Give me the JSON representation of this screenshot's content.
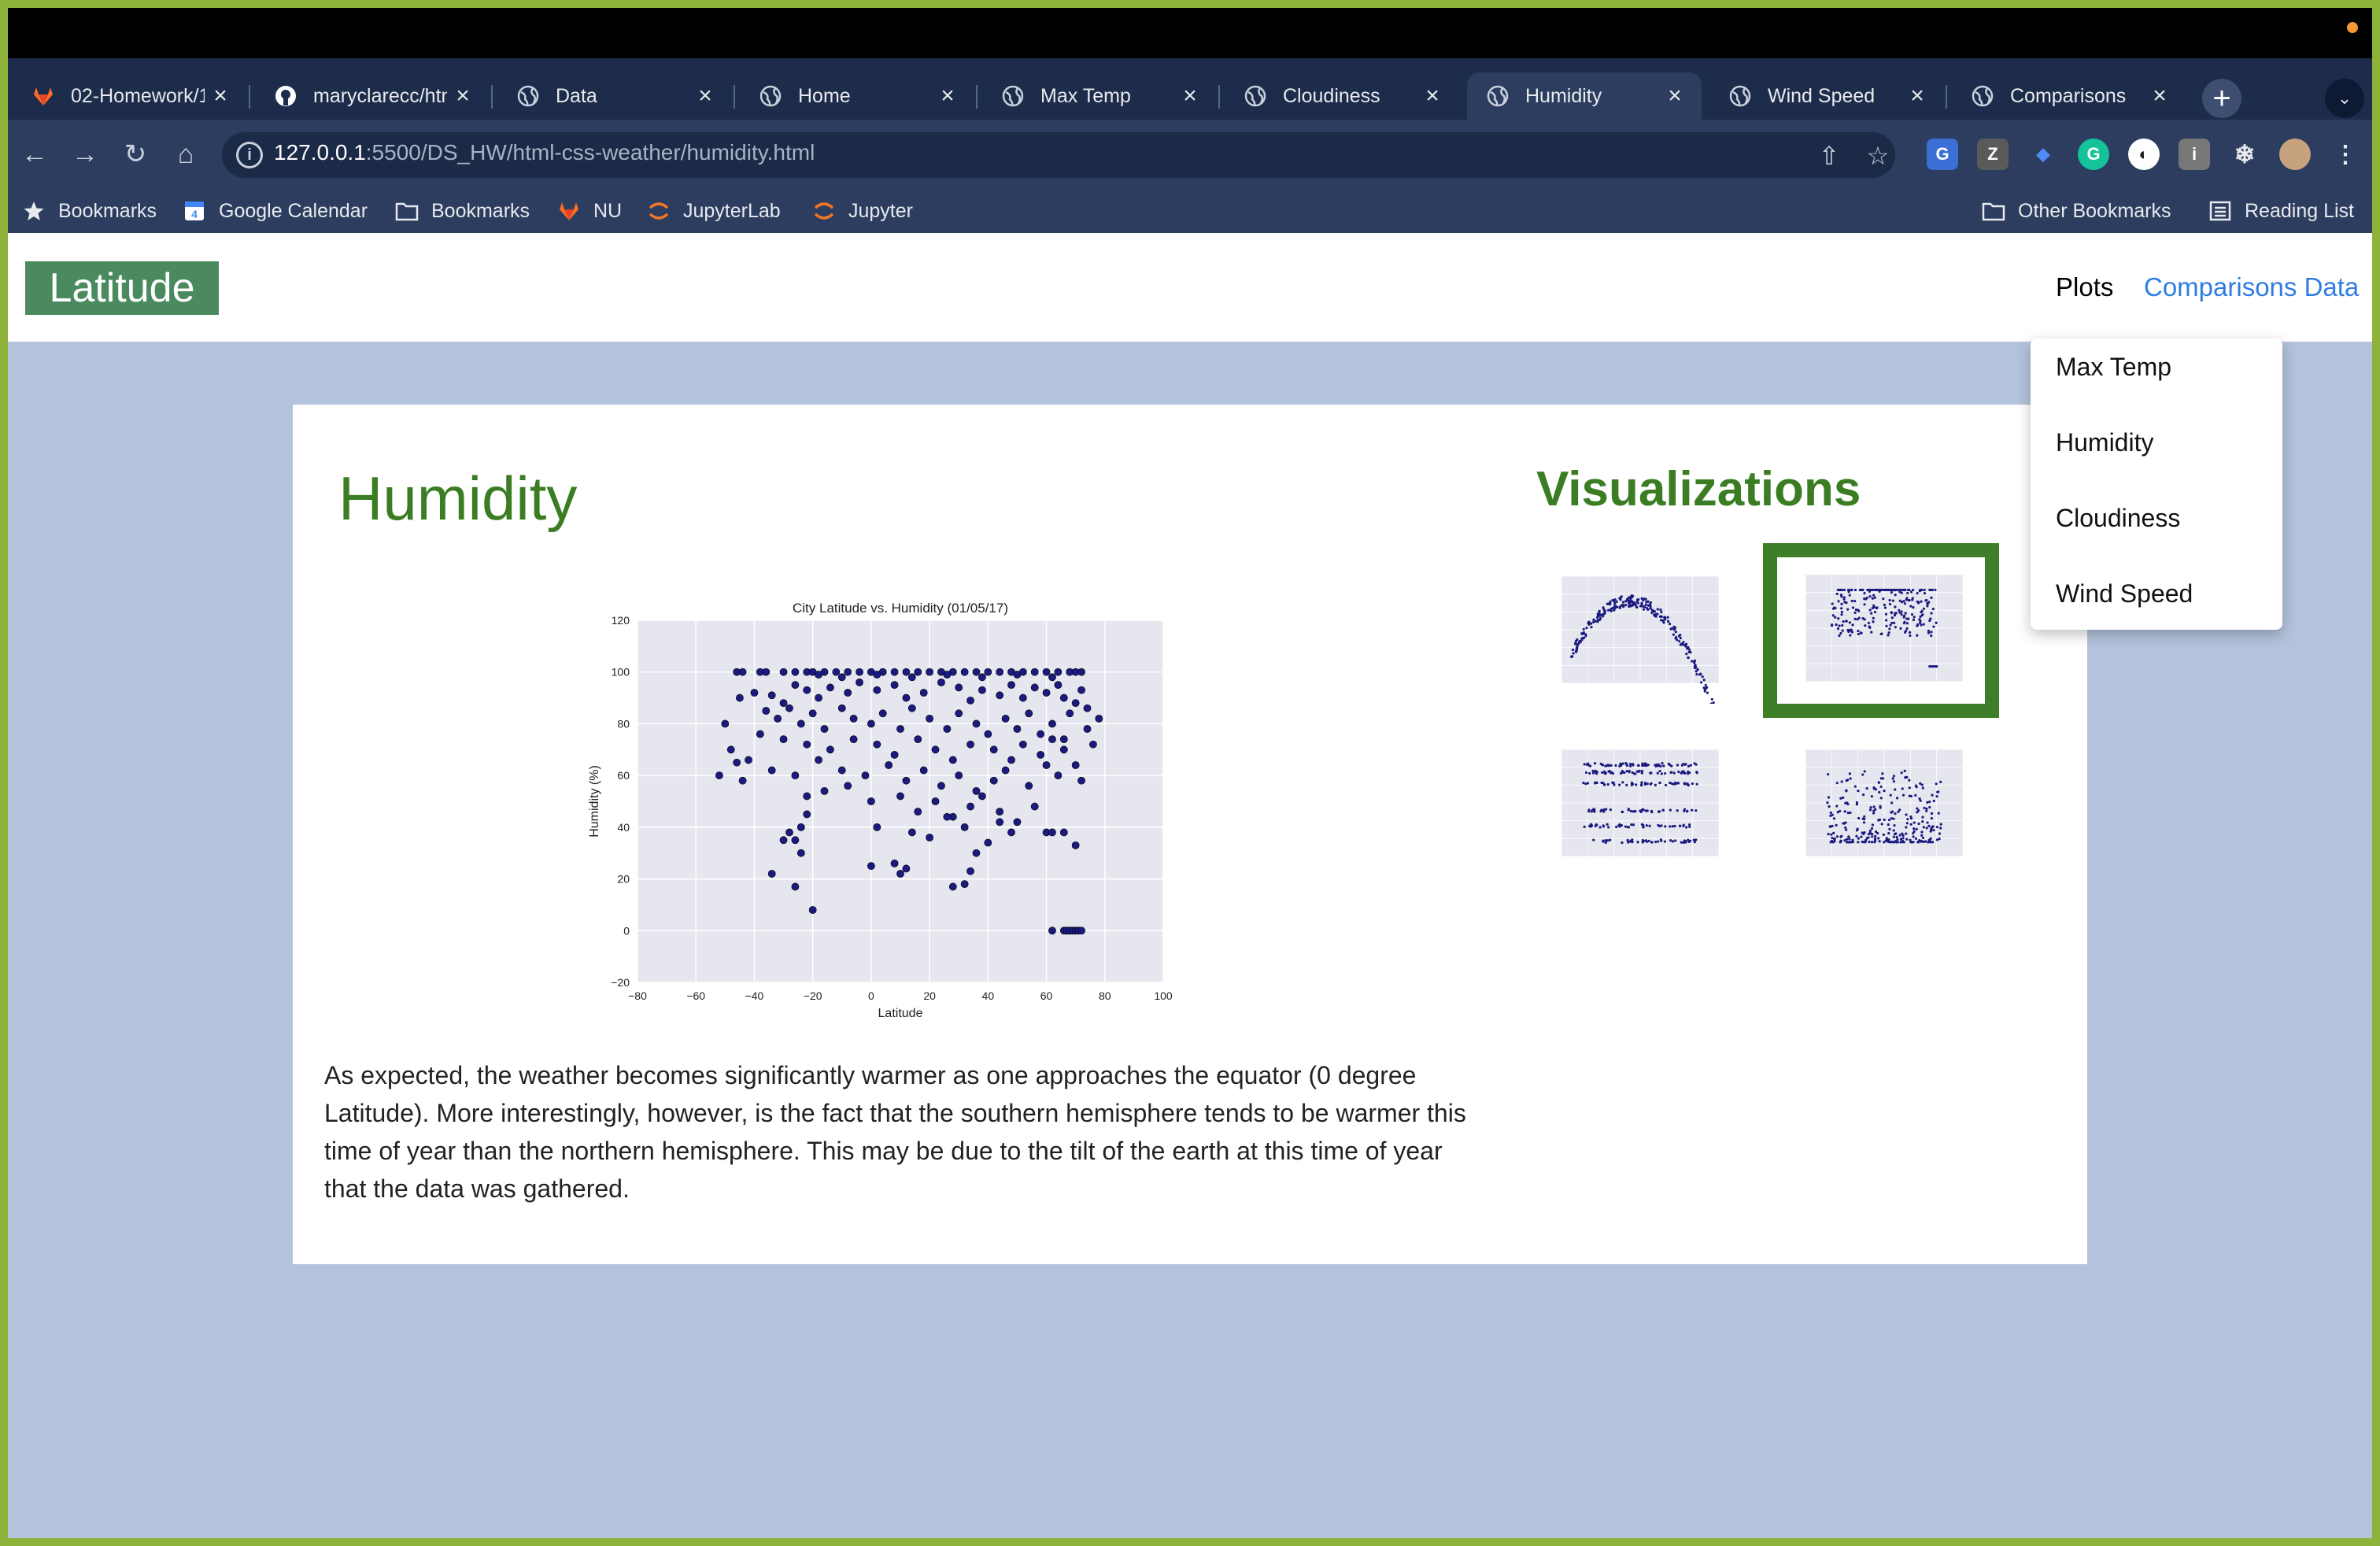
{
  "browser": {
    "tabs": [
      {
        "title": "02-Homework/1",
        "icon": "gitlab-icon"
      },
      {
        "title": "maryclarecc/htm",
        "icon": "github-icon"
      },
      {
        "title": "Data",
        "icon": "globe-icon"
      },
      {
        "title": "Home",
        "icon": "globe-icon"
      },
      {
        "title": "Max Temp",
        "icon": "globe-icon"
      },
      {
        "title": "Cloudiness",
        "icon": "globe-icon"
      },
      {
        "title": "Humidity",
        "icon": "globe-icon",
        "active": true
      },
      {
        "title": "Wind Speed",
        "icon": "globe-icon"
      },
      {
        "title": "Comparisons",
        "icon": "globe-icon"
      }
    ],
    "url_host": "127.0.0.1",
    "url_rest": ":5500/DS_HW/html-css-weather/humidity.html",
    "bookmarks": [
      {
        "label": "Bookmarks",
        "icon": "star-icon"
      },
      {
        "label": "Google Calendar",
        "icon": "calendar-icon"
      },
      {
        "label": "Bookmarks",
        "icon": "folder-icon"
      },
      {
        "label": "NU",
        "icon": "gitlab-icon"
      },
      {
        "label": "JupyterLab",
        "icon": "jupyter-icon"
      },
      {
        "label": "Jupyter",
        "icon": "jupyter-icon"
      }
    ],
    "other_bookmarks": "Other Bookmarks",
    "reading_list": "Reading List"
  },
  "navbar": {
    "brand": "Latitude",
    "plots": "Plots",
    "comparisons": "Comparisons Data",
    "dropdown": [
      "Max Temp",
      "Humidity",
      "Cloudiness",
      "Wind Speed"
    ]
  },
  "main": {
    "heading": "Humidity",
    "description": "As expected, the weather becomes significantly warmer as one approaches the equator (0 degree Latitude). More interestingly, however, is the fact that the southern hemisphere tends to be warmer this time of year than the northern hemisphere. This may be due to the tilt of the earth at this time of year that the data was gathered."
  },
  "sidebar": {
    "heading": "Visualizations",
    "thumbnails": [
      "Max Temp",
      "Humidity",
      "Cloudiness",
      "Wind Speed"
    ],
    "selected": "Humidity"
  },
  "colors": {
    "accent_green": "#3a7d22",
    "brand_bg": "#4b8a5f",
    "link_blue": "#2f7de1",
    "point_color": "#1a1a80",
    "plot_bg": "#e5e6ee"
  },
  "chart_data": {
    "type": "scatter",
    "title": "City Latitude vs. Humidity (01/05/17)",
    "xlabel": "Latitude",
    "ylabel": "Humidity (%)",
    "xlim": [
      -80,
      100
    ],
    "ylim": [
      -20,
      120
    ],
    "xticks": [
      -80,
      -60,
      -40,
      -20,
      0,
      20,
      40,
      60,
      80,
      100
    ],
    "yticks": [
      -20,
      0,
      20,
      40,
      60,
      80,
      100,
      120
    ],
    "grid": true,
    "points": [
      [
        -46,
        100
      ],
      [
        -44,
        100
      ],
      [
        -38,
        100
      ],
      [
        -36,
        100
      ],
      [
        -30,
        100
      ],
      [
        -26,
        100
      ],
      [
        -22,
        100
      ],
      [
        -20,
        100
      ],
      [
        -16,
        100
      ],
      [
        -12,
        100
      ],
      [
        -8,
        100
      ],
      [
        -4,
        100
      ],
      [
        0,
        100
      ],
      [
        4,
        100
      ],
      [
        8,
        100
      ],
      [
        12,
        100
      ],
      [
        16,
        100
      ],
      [
        20,
        100
      ],
      [
        24,
        100
      ],
      [
        28,
        100
      ],
      [
        32,
        100
      ],
      [
        36,
        100
      ],
      [
        40,
        100
      ],
      [
        44,
        100
      ],
      [
        48,
        100
      ],
      [
        52,
        100
      ],
      [
        56,
        100
      ],
      [
        60,
        100
      ],
      [
        64,
        100
      ],
      [
        68,
        100
      ],
      [
        70,
        100
      ],
      [
        72,
        100
      ],
      [
        -18,
        99
      ],
      [
        -10,
        98
      ],
      [
        2,
        99
      ],
      [
        14,
        98
      ],
      [
        26,
        99
      ],
      [
        38,
        98
      ],
      [
        50,
        99
      ],
      [
        62,
        98
      ],
      [
        -45,
        90
      ],
      [
        -40,
        92
      ],
      [
        -34,
        91
      ],
      [
        -30,
        88
      ],
      [
        -26,
        95
      ],
      [
        -22,
        93
      ],
      [
        -18,
        90
      ],
      [
        -14,
        94
      ],
      [
        -8,
        92
      ],
      [
        -4,
        96
      ],
      [
        2,
        93
      ],
      [
        8,
        95
      ],
      [
        12,
        90
      ],
      [
        18,
        92
      ],
      [
        24,
        96
      ],
      [
        30,
        94
      ],
      [
        34,
        89
      ],
      [
        38,
        93
      ],
      [
        44,
        91
      ],
      [
        48,
        95
      ],
      [
        52,
        90
      ],
      [
        56,
        94
      ],
      [
        60,
        92
      ],
      [
        64,
        95
      ],
      [
        66,
        90
      ],
      [
        70,
        88
      ],
      [
        72,
        93
      ],
      [
        74,
        86
      ],
      [
        -36,
        85
      ],
      [
        -32,
        82
      ],
      [
        -28,
        86
      ],
      [
        -24,
        80
      ],
      [
        -20,
        84
      ],
      [
        -16,
        78
      ],
      [
        -10,
        86
      ],
      [
        -6,
        82
      ],
      [
        0,
        80
      ],
      [
        4,
        84
      ],
      [
        10,
        78
      ],
      [
        14,
        86
      ],
      [
        20,
        82
      ],
      [
        26,
        78
      ],
      [
        30,
        84
      ],
      [
        36,
        80
      ],
      [
        40,
        76
      ],
      [
        46,
        82
      ],
      [
        50,
        78
      ],
      [
        54,
        84
      ],
      [
        58,
        76
      ],
      [
        62,
        80
      ],
      [
        66,
        74
      ],
      [
        68,
        84
      ],
      [
        74,
        78
      ],
      [
        78,
        82
      ],
      [
        -38,
        76
      ],
      [
        -30,
        74
      ],
      [
        -22,
        72
      ],
      [
        -14,
        70
      ],
      [
        -6,
        74
      ],
      [
        2,
        72
      ],
      [
        8,
        68
      ],
      [
        16,
        74
      ],
      [
        22,
        70
      ],
      [
        28,
        66
      ],
      [
        34,
        72
      ],
      [
        42,
        70
      ],
      [
        48,
        66
      ],
      [
        52,
        72
      ],
      [
        58,
        68
      ],
      [
        62,
        74
      ],
      [
        66,
        70
      ],
      [
        70,
        64
      ],
      [
        76,
        72
      ],
      [
        -50,
        80
      ],
      [
        -48,
        70
      ],
      [
        -42,
        66
      ],
      [
        -34,
        62
      ],
      [
        -26,
        60
      ],
      [
        -18,
        66
      ],
      [
        -10,
        62
      ],
      [
        -2,
        60
      ],
      [
        6,
        64
      ],
      [
        12,
        58
      ],
      [
        18,
        62
      ],
      [
        24,
        56
      ],
      [
        30,
        60
      ],
      [
        36,
        54
      ],
      [
        42,
        58
      ],
      [
        46,
        62
      ],
      [
        54,
        56
      ],
      [
        60,
        64
      ],
      [
        64,
        60
      ],
      [
        72,
        58
      ],
      [
        -52,
        60
      ],
      [
        -44,
        58
      ],
      [
        -22,
        52
      ],
      [
        -16,
        54
      ],
      [
        -8,
        56
      ],
      [
        0,
        50
      ],
      [
        10,
        52
      ],
      [
        16,
        46
      ],
      [
        22,
        50
      ],
      [
        28,
        44
      ],
      [
        34,
        48
      ],
      [
        38,
        52
      ],
      [
        44,
        46
      ],
      [
        50,
        42
      ],
      [
        56,
        48
      ],
      [
        -30,
        35
      ],
      [
        -28,
        38
      ],
      [
        -26,
        35
      ],
      [
        -24,
        40
      ],
      [
        -22,
        45
      ],
      [
        2,
        40
      ],
      [
        14,
        38
      ],
      [
        20,
        36
      ],
      [
        26,
        44
      ],
      [
        32,
        40
      ],
      [
        40,
        34
      ],
      [
        44,
        42
      ],
      [
        48,
        38
      ],
      [
        -46,
        65
      ],
      [
        -24,
        30
      ],
      [
        -34,
        22
      ],
      [
        -26,
        17
      ],
      [
        -20,
        8
      ],
      [
        0,
        25
      ],
      [
        8,
        26
      ],
      [
        10,
        22
      ],
      [
        12,
        24
      ],
      [
        28,
        17
      ],
      [
        32,
        18
      ],
      [
        34,
        23
      ],
      [
        36,
        30
      ],
      [
        60,
        38
      ],
      [
        62,
        38
      ],
      [
        66,
        38
      ],
      [
        70,
        33
      ],
      [
        62,
        0
      ],
      [
        66,
        0
      ],
      [
        67,
        0
      ],
      [
        68,
        0
      ],
      [
        69,
        0
      ],
      [
        70,
        0
      ],
      [
        71,
        0
      ],
      [
        72,
        0
      ]
    ]
  }
}
